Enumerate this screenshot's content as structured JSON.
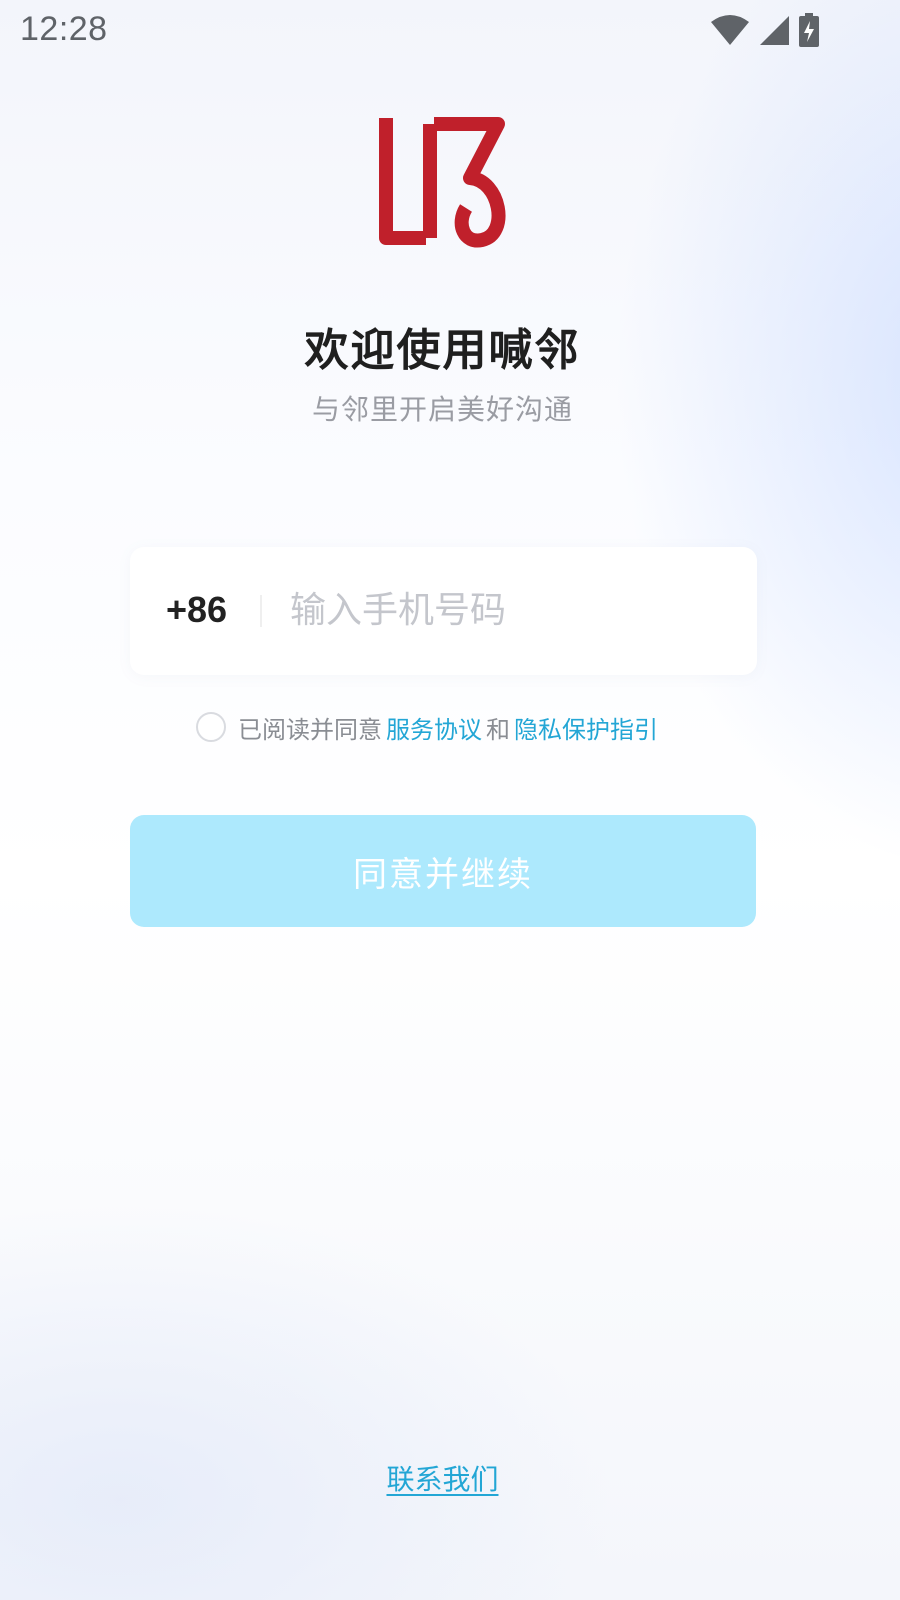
{
  "status_bar": {
    "time": "12:28",
    "icons": [
      "wifi-icon",
      "cellular-signal-icon",
      "battery-charging-icon"
    ]
  },
  "app": {
    "logo": "hanlin-logo",
    "title": "欢迎使用喊邻",
    "subtitle": "与邻里开启美好沟通"
  },
  "login_form": {
    "country_code": "+86",
    "phone_placeholder": "输入手机号码",
    "phone_value": ""
  },
  "agreement": {
    "checked": false,
    "prefix": "已阅读并同意",
    "service_link": "服务协议",
    "conjunction": "和",
    "privacy_link": "隐私保护指引"
  },
  "actions": {
    "continue_label": "同意并继续",
    "contact_label": "联系我们"
  },
  "colors": {
    "brand_red": "#c0202b",
    "link_blue": "#23a6d5",
    "button_disabled": "#ade9fd"
  }
}
